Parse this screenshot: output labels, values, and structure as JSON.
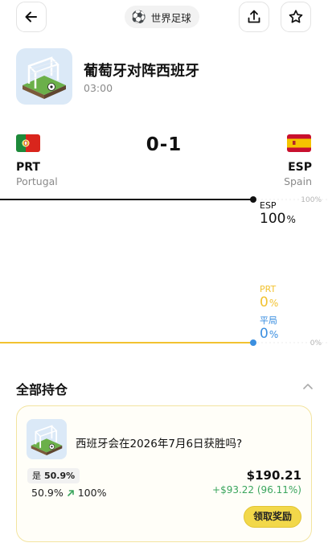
{
  "header": {
    "category_label": "世界足球",
    "icons": {
      "back": "arrow-left-icon",
      "share": "share-upload-icon",
      "favorite": "star-outline-icon",
      "category": "soccer-ball-icon"
    }
  },
  "market": {
    "title": "葡萄牙对阵西班牙",
    "time": "03:00",
    "thumbnail": "soccer-goal-illustration"
  },
  "match": {
    "score": "0-1",
    "home": {
      "code": "PRT",
      "name": "Portugal",
      "flag": "portugal-flag-icon"
    },
    "away": {
      "code": "ESP",
      "name": "Spain",
      "flag": "spain-flag-icon"
    }
  },
  "chart_data": {
    "type": "line",
    "y_ticks": [
      "100%",
      "0%"
    ],
    "ylim": [
      0,
      100
    ],
    "legend_placement": "right",
    "series": [
      {
        "name": "ESP",
        "color": "#111111",
        "value_text": "100",
        "unit": "%",
        "values": [
          100,
          100
        ]
      },
      {
        "name": "PRT",
        "color": "#f2c230",
        "value_text": "0",
        "unit": "%",
        "values": [
          0,
          0
        ]
      },
      {
        "name": "平局",
        "color": "#3b8fe0",
        "value_text": "0",
        "unit": "%",
        "values": [
          0,
          0
        ]
      }
    ]
  },
  "positions": {
    "title": "全部持仓",
    "card": {
      "question": "西班牙会在2026年7月6日获胜吗?",
      "outcome_label": "是",
      "outcome_price": "50.9%",
      "avg_price": "50.9%",
      "current_price": "100%",
      "value": "$190.21",
      "gain": "+$93.22 (96.11%)",
      "claim_label": "领取奖励"
    }
  },
  "colors": {
    "accent_yellow": "#f2d84a",
    "gain_green": "#3aa55d",
    "draw_blue": "#3b8fe0",
    "prt_yellow": "#f2c230"
  }
}
